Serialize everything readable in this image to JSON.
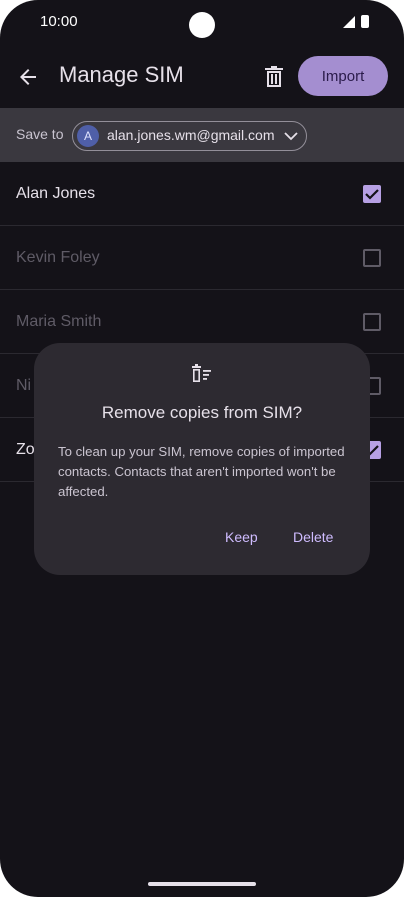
{
  "status_bar": {
    "time": "10:00"
  },
  "app_bar": {
    "title": "Manage SIM",
    "import_label": "Import",
    "icons": [
      "back-arrow-icon",
      "trash-icon"
    ]
  },
  "save_to": {
    "label": "Save to",
    "avatar_letter": "A",
    "email": "alan.jones.wm@gmail.com"
  },
  "contacts": [
    {
      "name": "Alan Jones",
      "checked": true,
      "enabled": true
    },
    {
      "name": "Kevin Foley",
      "checked": false,
      "enabled": false
    },
    {
      "name": "Maria Smith",
      "checked": false,
      "enabled": false
    },
    {
      "name": "Ni",
      "checked": false,
      "enabled": false
    },
    {
      "name": "Zo",
      "checked": true,
      "enabled": true
    }
  ],
  "dialog": {
    "icon": "remove-from-sim-icon",
    "title": "Remove copies from SIM?",
    "body": "To clean up your SIM, remove copies of imported contacts. Contacts that aren't imported won't be affected.",
    "keep_label": "Keep",
    "delete_label": "Delete"
  },
  "colors": {
    "background": "#141218",
    "accent": "#a48ed0",
    "dialog": "#2d2a31",
    "save_bar": "#3a383f"
  }
}
